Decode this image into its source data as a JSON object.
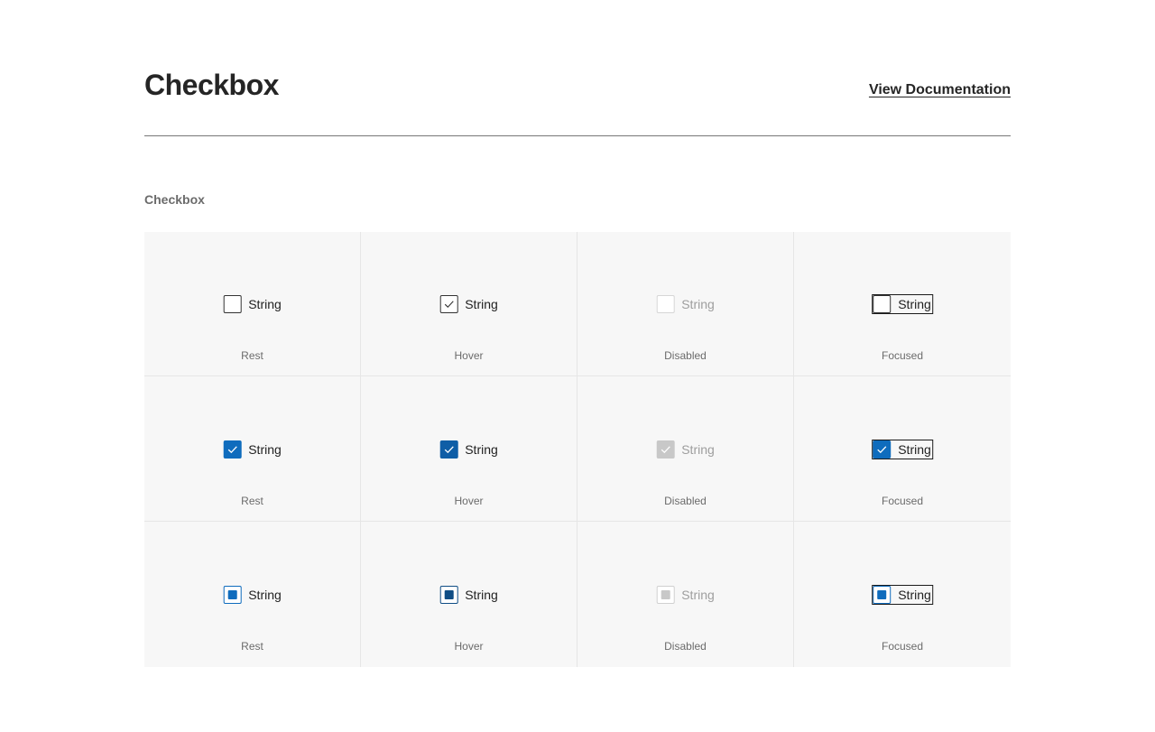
{
  "header": {
    "title": "Checkbox",
    "doc_link": "View Documentation"
  },
  "section": {
    "label": "Checkbox"
  },
  "colors": {
    "accent": "#0f6cbd",
    "accent_hover": "#0f5ea6",
    "disabled_fill": "#c8c8c8",
    "cell_background": "#f7f7f7"
  },
  "rows": [
    {
      "variant": "unchecked",
      "cells": [
        {
          "label": "String",
          "state": "Rest"
        },
        {
          "label": "String",
          "state": "Hover"
        },
        {
          "label": "String",
          "state": "Disabled"
        },
        {
          "label": "String",
          "state": "Focused"
        }
      ]
    },
    {
      "variant": "checked",
      "cells": [
        {
          "label": "String",
          "state": "Rest"
        },
        {
          "label": "String",
          "state": "Hover"
        },
        {
          "label": "String",
          "state": "Disabled"
        },
        {
          "label": "String",
          "state": "Focused"
        }
      ]
    },
    {
      "variant": "indeterminate",
      "cells": [
        {
          "label": "String",
          "state": "Rest"
        },
        {
          "label": "String",
          "state": "Hover"
        },
        {
          "label": "String",
          "state": "Disabled"
        },
        {
          "label": "String",
          "state": "Focused"
        }
      ]
    }
  ]
}
